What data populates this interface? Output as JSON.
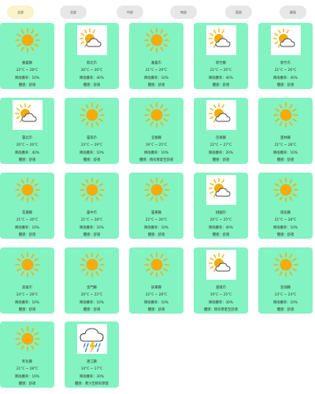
{
  "tabs": [
    {
      "label": "全部",
      "active": true
    },
    {
      "label": "北部",
      "active": false
    },
    {
      "label": "中部",
      "active": false
    },
    {
      "label": "南部",
      "active": false
    },
    {
      "label": "東部",
      "active": false
    },
    {
      "label": "離島",
      "active": false
    }
  ],
  "colors": {
    "card": "#83f3c1",
    "sun": "#f5ac0a",
    "tab_active": "#fbf3c9",
    "tab": "#e7e7e7"
  },
  "cities": [
    {
      "name": "嘉義縣",
      "temp": "22°C ~ 28°C",
      "rain": "降雨機率：10%",
      "comfort": "體感：舒適",
      "icon": "sun-icon"
    },
    {
      "name": "新北市",
      "temp": "20°C ~ 26°C",
      "rain": "降雨機率：40%",
      "comfort": "體感：舒適",
      "icon": "partly-cloudy-icon"
    },
    {
      "name": "嘉義市",
      "temp": "21°C ~ 29°C",
      "rain": "降雨機率：10%",
      "comfort": "體感：舒適",
      "icon": "sun-icon"
    },
    {
      "name": "新竹縣",
      "temp": "21°C ~ 26°C",
      "rain": "降雨機率：40%",
      "comfort": "體感：舒適",
      "icon": "partly-cloudy-icon"
    },
    {
      "name": "新竹市",
      "temp": "21°C ~ 26°C",
      "rain": "降雨機率：40%",
      "comfort": "體感：舒適",
      "icon": "partly-cloudy-icon"
    },
    {
      "name": "臺北市",
      "temp": "20°C ~ 26°C",
      "rain": "降雨機率：40%",
      "comfort": "體感：舒適",
      "icon": "partly-cloudy-icon"
    },
    {
      "name": "臺南市",
      "temp": "23°C ~ 29°C",
      "rain": "降雨機率：10%",
      "comfort": "體感：舒適",
      "icon": "sun-icon"
    },
    {
      "name": "宜蘭縣",
      "temp": "19°C ~ 25°C",
      "rain": "降雨機率：10%",
      "comfort": "體感：稍有寒意至舒適",
      "icon": "sun-icon"
    },
    {
      "name": "苗栗縣",
      "temp": "22°C ~ 27°C",
      "rain": "降雨機率：20%",
      "comfort": "體感：舒適",
      "icon": "partly-cloudy-icon"
    },
    {
      "name": "雲林縣",
      "temp": "21°C ~ 28°C",
      "rain": "降雨機率：10%",
      "comfort": "體感：舒適",
      "icon": "sun-icon"
    },
    {
      "name": "花蓮縣",
      "temp": "21°C ~ 26°C",
      "rain": "降雨機率：10%",
      "comfort": "體感：舒適",
      "icon": "sun-icon"
    },
    {
      "name": "臺中市",
      "temp": "21°C ~ 28°C",
      "rain": "降雨機率：10%",
      "comfort": "體感：舒適",
      "icon": "sun-icon"
    },
    {
      "name": "臺東縣",
      "temp": "22°C ~ 26°C",
      "rain": "降雨機率：10%",
      "comfort": "體感：舒適",
      "icon": "sun-icon"
    },
    {
      "name": "桃園市",
      "temp": "20°C ~ 25°C",
      "rain": "降雨機率：40%",
      "comfort": "體感：舒適",
      "icon": "partly-cloudy-icon"
    },
    {
      "name": "南投縣",
      "temp": "21°C ~ 28°C",
      "rain": "降雨機率：10%",
      "comfort": "體感：舒適",
      "icon": "sun-icon"
    },
    {
      "name": "高雄市",
      "temp": "24°C ~ 28°C",
      "rain": "降雨機率：10%",
      "comfort": "體感：舒適",
      "icon": "sun-icon"
    },
    {
      "name": "金門縣",
      "temp": "20°C ~ 22°C",
      "rain": "降雨機率：10%",
      "comfort": "體感：舒適",
      "icon": "sun-icon"
    },
    {
      "name": "屏東縣",
      "temp": "22°C ~ 28°C",
      "rain": "降雨機率：10%",
      "comfort": "體感：舒適",
      "icon": "sun-icon"
    },
    {
      "name": "基隆市",
      "temp": "19°C ~ 25°C",
      "rain": "降雨機率：30%",
      "comfort": "體感：稍有寒意至舒適",
      "icon": "partly-cloudy-icon"
    },
    {
      "name": "澎湖縣",
      "temp": "23°C ~ 24°C",
      "rain": "降雨機率：10%",
      "comfort": "體感：舒適",
      "icon": "sun-icon"
    },
    {
      "name": "彰化縣",
      "temp": "21°C ~ 28°C",
      "rain": "降雨機率：10%",
      "comfort": "體感：舒適",
      "icon": "sun-icon"
    },
    {
      "name": "連江縣",
      "temp": "14°C ~ 17°C",
      "rain": "降雨機率：30%",
      "comfort": "體感：寒冷至稍有寒意",
      "icon": "thunderstorm-icon"
    }
  ]
}
